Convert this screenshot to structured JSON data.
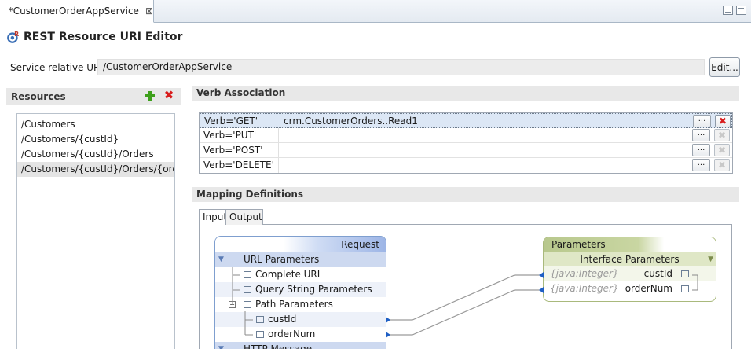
{
  "tab": {
    "title": "*CustomerOrderAppService"
  },
  "editor": {
    "title": "REST Resource URI Editor"
  },
  "uri": {
    "label": "Service relative URI:",
    "value": "/CustomerOrderAppService",
    "edit_label": "Edit..."
  },
  "resources": {
    "header": "Resources",
    "items": [
      "/Customers",
      "/Customers/{custId}",
      "/Customers/{custId}/Orders",
      "/Customers/{custId}/Orders/{orde..."
    ]
  },
  "verb_association": {
    "header": "Verb Association",
    "rows": [
      {
        "verb": "Verb='GET'",
        "operation": "crm.CustomerOrders..Read1"
      },
      {
        "verb": "Verb='PUT'",
        "operation": ""
      },
      {
        "verb": "Verb='POST'",
        "operation": ""
      },
      {
        "verb": "Verb='DELETE'",
        "operation": ""
      }
    ],
    "dots_label": "...",
    "delete_glyph": "✖"
  },
  "mapping": {
    "header": "Mapping Definitions",
    "tabs": [
      "Input",
      "Output"
    ],
    "request": {
      "title": "Request",
      "url_parameters": "URL Parameters",
      "complete_url": "Complete URL",
      "query_string": "Query String Parameters",
      "path_parameters": "Path Parameters",
      "cust_id": "custId",
      "order_num": "orderNum",
      "http_message": "HTTP Message"
    },
    "parameters": {
      "title": "Parameters",
      "interface": "Interface Parameters",
      "rows": [
        {
          "type": "{java:Integer}",
          "name": "custId"
        },
        {
          "type": "{java:Integer}",
          "name": "orderNum"
        }
      ]
    }
  },
  "colors": {
    "accent": "#3ea01c",
    "delete": "#d81c1c",
    "request_header": "#9db5e6",
    "parameters_header": "#b8c88d"
  }
}
